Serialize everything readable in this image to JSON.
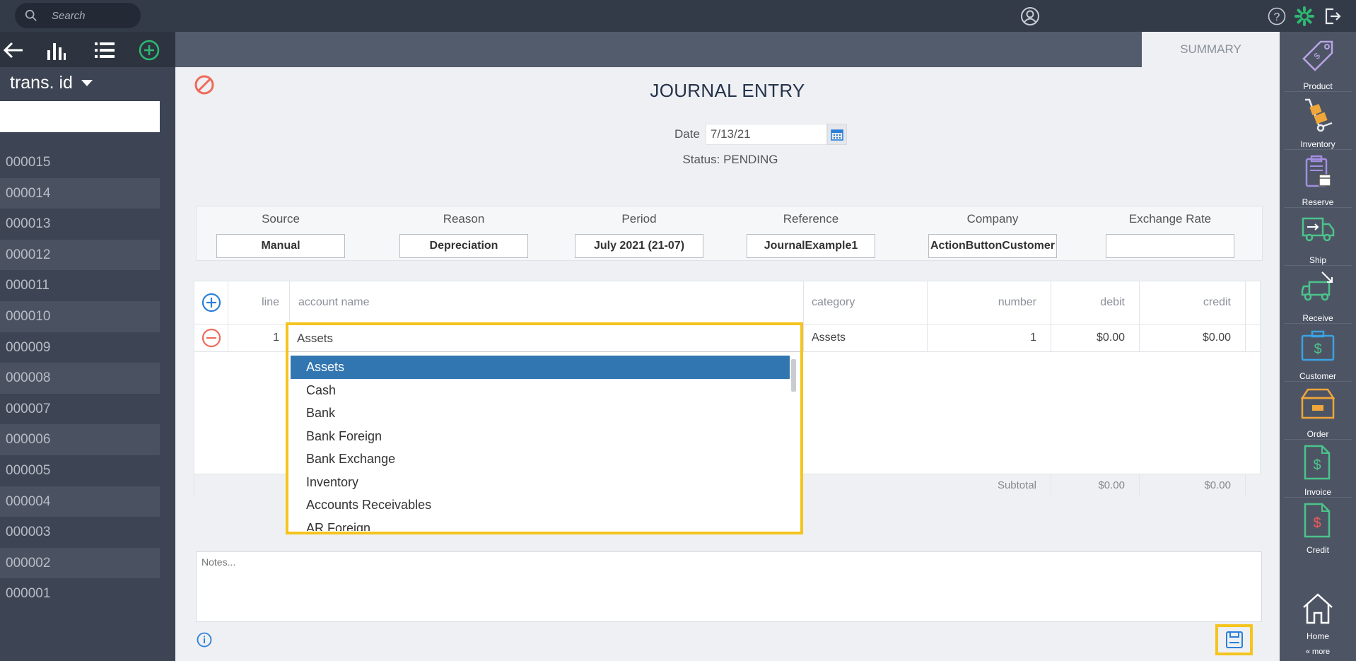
{
  "topbar": {
    "search_placeholder": "Search"
  },
  "leftnav": {
    "sort_label": "trans. id",
    "items": [
      "000015",
      "000014",
      "000013",
      "000012",
      "000011",
      "000010",
      "000009",
      "000008",
      "000007",
      "000006",
      "000005",
      "000004",
      "000003",
      "000002",
      "000001"
    ]
  },
  "tabs": {
    "summary": "SUMMARY"
  },
  "rightbar": {
    "items": [
      {
        "label": "Product",
        "icon": "tag-icon"
      },
      {
        "label": "Inventory",
        "icon": "hand-truck-icon"
      },
      {
        "label": "Reserve",
        "icon": "clipboard-icon"
      },
      {
        "label": "Ship",
        "icon": "ship-truck-icon"
      },
      {
        "label": "Receive",
        "icon": "receive-truck-icon"
      },
      {
        "label": "Customer",
        "icon": "briefcase-icon"
      },
      {
        "label": "Order",
        "icon": "box-icon"
      },
      {
        "label": "Invoice",
        "icon": "invoice-icon"
      },
      {
        "label": "Credit",
        "icon": "credit-icon"
      }
    ],
    "home": "Home",
    "more": "« more"
  },
  "journal": {
    "title": "JOURNAL ENTRY",
    "date_label": "Date",
    "date_value": "7/13/21",
    "status": "Status: PENDING",
    "fields": [
      {
        "label": "Source",
        "value": "Manual"
      },
      {
        "label": "Reason",
        "value": "Depreciation"
      },
      {
        "label": "Period",
        "value": "July 2021 (21-07)"
      },
      {
        "label": "Reference",
        "value": "JournalExample1"
      },
      {
        "label": "Company",
        "value": "ActionButtonCustomer"
      },
      {
        "label": "Exchange Rate",
        "value": ""
      }
    ]
  },
  "grid": {
    "headers": {
      "line": "line",
      "account_name": "account name",
      "category": "category",
      "number": "number",
      "debit": "debit",
      "credit": "credit"
    },
    "rows": [
      {
        "line": "1",
        "account_name": "Assets",
        "category": "Assets",
        "number": "1",
        "debit": "$0.00",
        "credit": "$0.00"
      }
    ],
    "subtotal_label": "Subtotal",
    "subtotal_debit": "$0.00",
    "subtotal_credit": "$0.00"
  },
  "dropdown": {
    "options": [
      "Assets",
      "Cash",
      "Bank",
      "Bank Foreign",
      "Bank Exchange",
      "Inventory",
      "Accounts Receivables",
      "AR Foreign"
    ],
    "selected": "Assets"
  },
  "notes": {
    "placeholder": "Notes..."
  },
  "colors": {
    "highlight": "#f5c41d",
    "selected_option": "#3276b1",
    "accent_green": "#2eb872",
    "cancel_red": "#ee6a5a",
    "add_blue": "#2b7fd8"
  }
}
